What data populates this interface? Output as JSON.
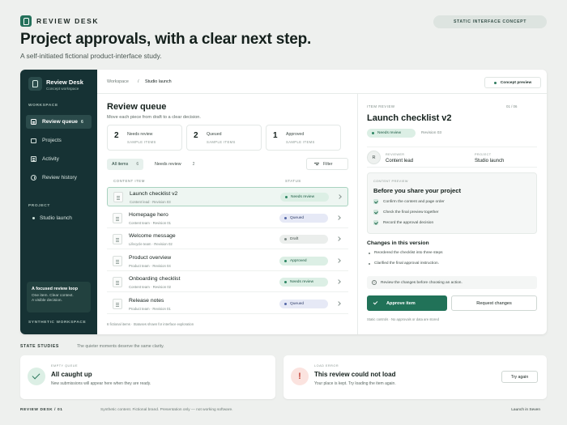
{
  "header": {
    "brand": "REVIEW DESK",
    "concept_badge": "STATIC INTERFACE CONCEPT",
    "title": "Project approvals, with a clear next step.",
    "subtitle": "A self-initiated fictional product-interface study."
  },
  "sidebar": {
    "app_name": "Review Desk",
    "app_sub": "Concept workspace",
    "workspace_label": "WORKSPACE",
    "items": [
      {
        "label": "Review queue",
        "badge": "6",
        "icon": "queue-icon"
      },
      {
        "label": "Projects",
        "icon": "folder-icon"
      },
      {
        "label": "Activity",
        "icon": "activity-icon"
      },
      {
        "label": "Review history",
        "icon": "history-icon"
      }
    ],
    "project_label": "PROJECT",
    "project": "Studio launch",
    "loop_title": "A focused review loop",
    "loop_lines": [
      "One item. Clear context.",
      "A visible decision."
    ],
    "footer": "SYNTHETIC WORKSPACE"
  },
  "topbar": {
    "crumb_1": "Workspace",
    "crumb_sep": "/",
    "crumb_2": "Studio launch",
    "preview_button": "Concept preview"
  },
  "queue": {
    "title": "Review queue",
    "subtitle": "Move each piece from draft to a clear decision.",
    "stats": [
      {
        "num": "2",
        "label": "Needs review",
        "caption": "SAMPLE ITEMS"
      },
      {
        "num": "2",
        "label": "Queued",
        "caption": "SAMPLE ITEMS"
      },
      {
        "num": "1",
        "label": "Approved",
        "caption": "SAMPLE ITEMS"
      }
    ],
    "tabs": [
      {
        "label": "All items",
        "count": "6"
      },
      {
        "label": "Needs review",
        "count": "2"
      }
    ],
    "filter": "Filter",
    "col_item": "CONTENT ITEM",
    "col_status": "STATUS",
    "rows": [
      {
        "title": "Launch checklist v2",
        "meta": "Content lead · Revision 03",
        "status": "Needs review"
      },
      {
        "title": "Homepage hero",
        "meta": "Content team · Revision 01",
        "status": "Queued"
      },
      {
        "title": "Welcome message",
        "meta": "Lifecycle team · Revision 02",
        "status": "Draft"
      },
      {
        "title": "Product overview",
        "meta": "Product team · Revision 04",
        "status": "Approved"
      },
      {
        "title": "Onboarding checklist",
        "meta": "Content team · Revision 02",
        "status": "Needs review"
      },
      {
        "title": "Release notes",
        "meta": "Product team · Revision 01",
        "status": "Queued"
      }
    ],
    "footer": "6 fictional items · Statuses shown for interface exploration"
  },
  "detail": {
    "eyebrow": "ITEM REVIEW",
    "page": "01 / 06",
    "title": "Launch checklist v2",
    "status": "Needs review",
    "revision": "Revision 03",
    "avatar": "R",
    "reviewer_cap": "REVIEWER",
    "reviewer": "Content lead",
    "project_cap": "PROJECT",
    "project": "Studio launch",
    "checklist_cap": "CONTENT PREVIEW",
    "checklist_title": "Before you share your project",
    "checklist": [
      "Confirm the content and page order",
      "Check the final preview together",
      "Record the approval decision"
    ],
    "changes_title": "Changes in this version",
    "changes": [
      "Reordered the checklist into three steps",
      "Clarified the final approval instruction."
    ],
    "note": "Review the changes before choosing an action.",
    "approve": "Approve item",
    "request": "Request changes",
    "static_note": "Static controls · No approvals or data are stored"
  },
  "states": {
    "label": "STATE STUDIES",
    "sub": "The quieter moments deserve the same clarity.",
    "empty_cap": "EMPTY QUEUE",
    "empty_title": "All caught up",
    "empty_body": "New submissions will appear here when they are ready.",
    "error_icon": "!",
    "error_cap": "LOAD ERROR",
    "error_title": "This review could not load",
    "error_body": "Your place is kept. Try loading the item again.",
    "retry": "Try again"
  },
  "footer": {
    "left": "REVIEW DESK / 01",
    "mid": "Synthetic content. Fictional brand. Presentation only — not working software.",
    "right": "Launch in Seven"
  },
  "colors": {
    "accent": "#217258",
    "sidebar": "#163234",
    "background": "#eef0ee",
    "needs_review": "#dcefe5",
    "queued": "#e6e9f6",
    "error": "#fbe3df"
  }
}
